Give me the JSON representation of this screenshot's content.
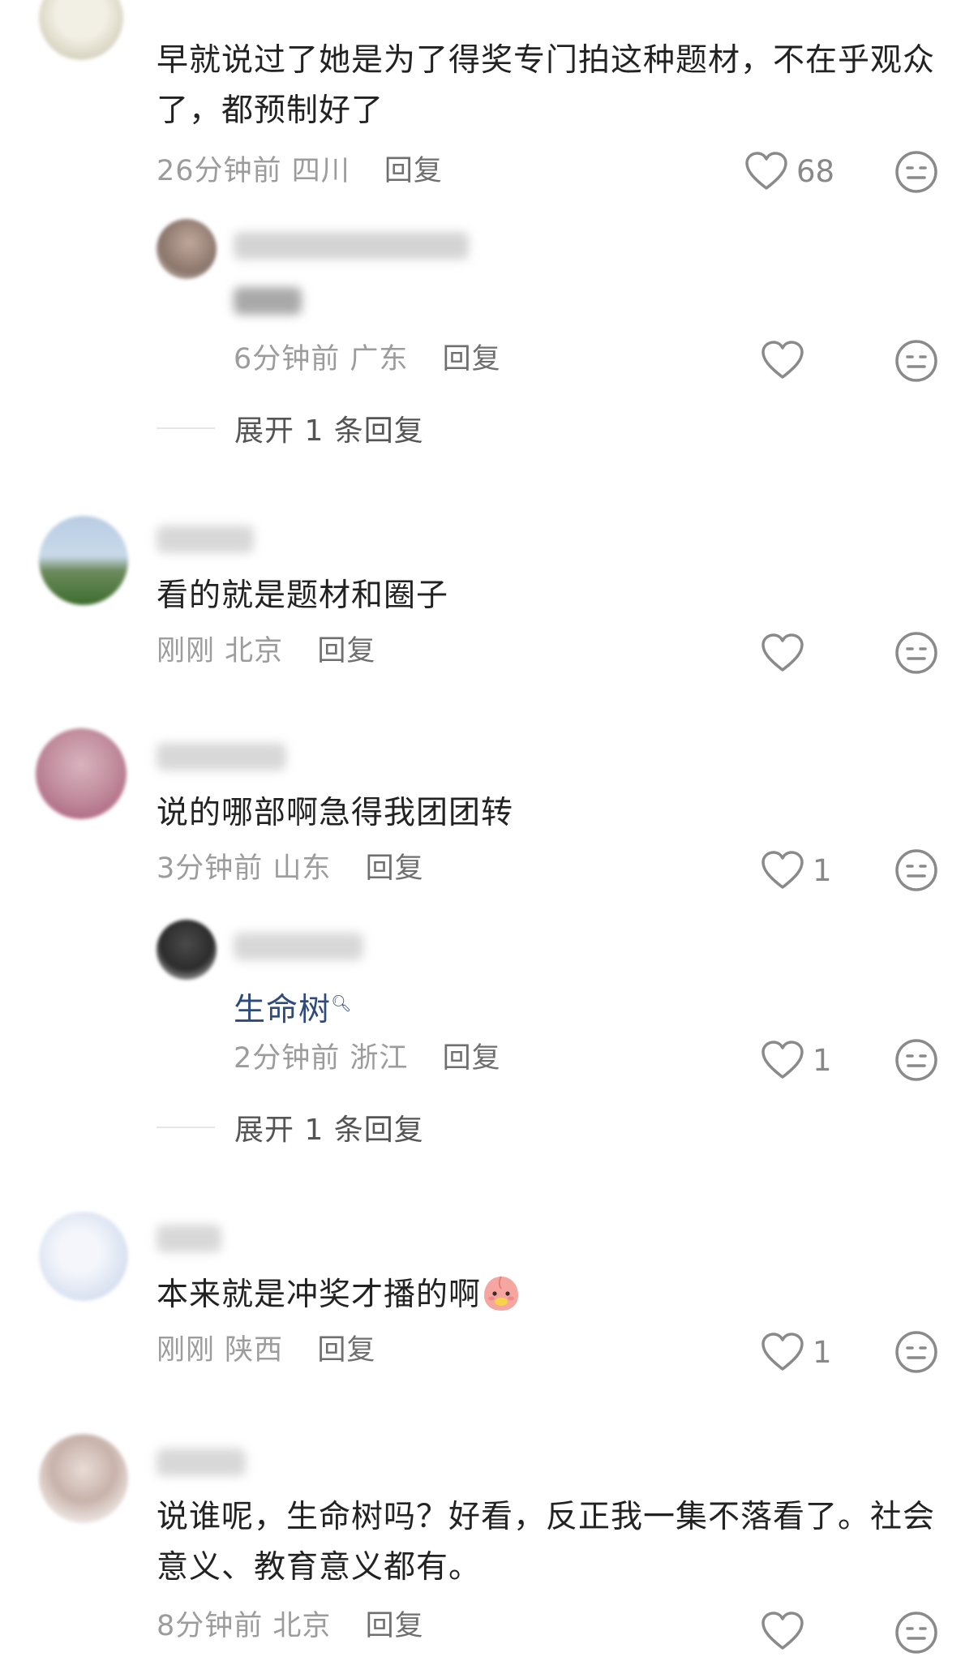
{
  "comments": [
    {
      "content": "早就说过了她是为了得奖专门拍这种题材，不在乎观众了，都预制好了",
      "time": "26分钟前",
      "location": "四川",
      "reply_label": "回复",
      "likes": "68",
      "replies": [
        {
          "content": "",
          "time": "6分钟前",
          "location": "广东",
          "reply_label": "回复",
          "likes": ""
        }
      ],
      "expand_label": "展开 1 条回复"
    },
    {
      "content": "看的就是题材和圈子",
      "time": "刚刚",
      "location": "北京",
      "reply_label": "回复",
      "likes": ""
    },
    {
      "content": "说的哪部啊急得我团团转",
      "time": "3分钟前",
      "location": "山东",
      "reply_label": "回复",
      "likes": "1",
      "replies": [
        {
          "content_link": "生命树",
          "time": "2分钟前",
          "location": "浙江",
          "reply_label": "回复",
          "likes": "1"
        }
      ],
      "expand_label": "展开 1 条回复"
    },
    {
      "content": "本来就是冲奖才播的啊",
      "time": "刚刚",
      "location": "陕西",
      "reply_label": "回复",
      "likes": "1"
    },
    {
      "content": "说谁呢，生命树吗？好看，反正我一集不落看了。社会意义、教育意义都有。",
      "time": "8分钟前",
      "location": "北京",
      "reply_label": "回复",
      "likes": ""
    }
  ],
  "icons": {
    "like": "heart-outline-icon",
    "dislike": "neutral-face-icon",
    "search": "search-mark-icon",
    "emoji": "peach-emoji-icon"
  },
  "colors": {
    "text": "#222222",
    "meta": "#9c9c9c",
    "link": "#2f4b7c",
    "icon": "#8a8a8a"
  }
}
